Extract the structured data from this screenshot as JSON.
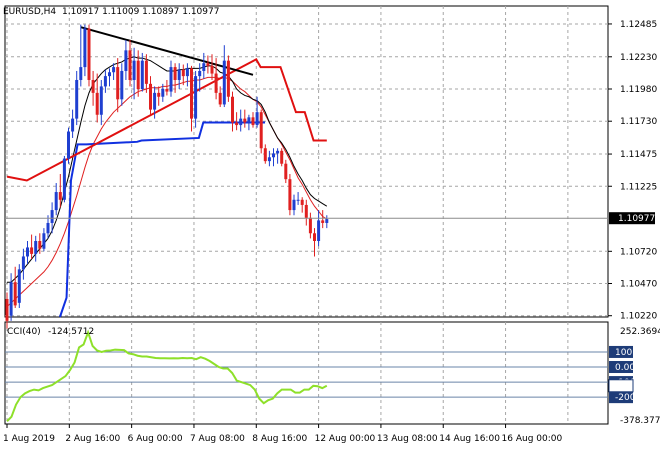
{
  "header": {
    "symbol": "EURUSD,H4",
    "ohlc": "1.10917 1.11009 1.10897 1.10977"
  },
  "indicator": {
    "name": "CCI(40)",
    "value": "-124.5712"
  },
  "colors": {
    "bull": "#1f3fd0",
    "bear": "#e02020",
    "ma_fast": "#000000",
    "ma_slow": "#e02020",
    "stop_blue": "#1030e0",
    "stop_red": "#e01010",
    "trendline": "#000000",
    "cci": "#8ee02a",
    "grid": "#a6a6a6",
    "level": "#6a84a8"
  },
  "chart_data": [
    {
      "type": "candlestick",
      "title": "EURUSD,H4",
      "x_tick_labels": [
        "1 Aug 2019",
        "2 Aug 16:00",
        "6 Aug 00:00",
        "7 Aug 08:00",
        "8 Aug 16:00",
        "12 Aug 00:00",
        "13 Aug 08:00",
        "14 Aug 16:00",
        "16 Aug 00:00"
      ],
      "y_tick_labels": [
        "1.12485",
        "1.12230",
        "1.11980",
        "1.11730",
        "1.11475",
        "1.11225",
        "1.10720",
        "1.10470",
        "1.10220"
      ],
      "ylim": [
        1.1021,
        1.1257
      ],
      "price_label": "1.10977",
      "candles": [
        [
          1.1035,
          1.104,
          1.1012,
          1.1018
        ],
        [
          1.1022,
          1.1055,
          1.1018,
          1.1048
        ],
        [
          1.1048,
          1.106,
          1.1028,
          1.103
        ],
        [
          1.1032,
          1.1062,
          1.1028,
          1.1058
        ],
        [
          1.1058,
          1.1074,
          1.105,
          1.1068
        ],
        [
          1.1068,
          1.108,
          1.1062,
          1.1075
        ],
        [
          1.1075,
          1.1085,
          1.1066,
          1.107
        ],
        [
          1.107,
          1.1084,
          1.1064,
          1.108
        ],
        [
          1.108,
          1.1086,
          1.107,
          1.1074
        ],
        [
          1.1074,
          1.109,
          1.1072,
          1.1086
        ],
        [
          1.1086,
          1.11,
          1.1082,
          1.1094
        ],
        [
          1.1094,
          1.111,
          1.1086,
          1.1104
        ],
        [
          1.1104,
          1.1125,
          1.11,
          1.1118
        ],
        [
          1.1118,
          1.1132,
          1.1106,
          1.1112
        ],
        [
          1.1112,
          1.1146,
          1.111,
          1.1144
        ],
        [
          1.1144,
          1.1168,
          1.114,
          1.1165
        ],
        [
          1.1165,
          1.1182,
          1.116,
          1.1175
        ],
        [
          1.1175,
          1.1212,
          1.117,
          1.1205
        ],
        [
          1.1205,
          1.1248,
          1.12,
          1.1215
        ],
        [
          1.1215,
          1.1248,
          1.1208,
          1.1245
        ],
        [
          1.1245,
          1.1248,
          1.12,
          1.1205
        ],
        [
          1.1205,
          1.1212,
          1.1185,
          1.1195
        ],
        [
          1.1195,
          1.121,
          1.1172,
          1.1178
        ],
        [
          1.1178,
          1.1205,
          1.117,
          1.12
        ],
        [
          1.12,
          1.1213,
          1.1195,
          1.1208
        ],
        [
          1.1208,
          1.1214,
          1.12,
          1.1211
        ],
        [
          1.1211,
          1.1218,
          1.1205,
          1.1215
        ],
        [
          1.1215,
          1.1222,
          1.118,
          1.119
        ],
        [
          1.119,
          1.1218,
          1.1185,
          1.1212
        ],
        [
          1.1212,
          1.1236,
          1.1205,
          1.1228
        ],
        [
          1.1228,
          1.1236,
          1.12,
          1.1205
        ],
        [
          1.1205,
          1.123,
          1.119,
          1.122
        ],
        [
          1.122,
          1.1228,
          1.1192,
          1.1198
        ],
        [
          1.1198,
          1.1226,
          1.1196,
          1.122
        ],
        [
          1.122,
          1.1225,
          1.1195,
          1.1202
        ],
        [
          1.1202,
          1.1208,
          1.1178,
          1.1182
        ],
        [
          1.1182,
          1.12,
          1.1175,
          1.1195
        ],
        [
          1.1195,
          1.12,
          1.1185,
          1.1192
        ],
        [
          1.1192,
          1.1202,
          1.1188,
          1.1198
        ],
        [
          1.1198,
          1.1205,
          1.1193,
          1.1196
        ],
        [
          1.1196,
          1.122,
          1.1192,
          1.1215
        ],
        [
          1.1215,
          1.1218,
          1.1195,
          1.1205
        ],
        [
          1.1205,
          1.1218,
          1.1198,
          1.1213
        ],
        [
          1.1213,
          1.1217,
          1.1201,
          1.1208
        ],
        [
          1.1208,
          1.1218,
          1.12,
          1.1214
        ],
        [
          1.1214,
          1.1216,
          1.1165,
          1.1175
        ],
        [
          1.1175,
          1.1212,
          1.1168,
          1.1208
        ],
        [
          1.1208,
          1.1218,
          1.1196,
          1.1212
        ],
        [
          1.1212,
          1.1226,
          1.1206,
          1.1218
        ],
        [
          1.1218,
          1.1224,
          1.121,
          1.1216
        ],
        [
          1.1216,
          1.1225,
          1.1205,
          1.121
        ],
        [
          1.121,
          1.1222,
          1.119,
          1.1195
        ],
        [
          1.1195,
          1.12,
          1.1184,
          1.1186
        ],
        [
          1.1186,
          1.1232,
          1.1184,
          1.122
        ],
        [
          1.122,
          1.1224,
          1.1188,
          1.1192
        ],
        [
          1.1192,
          1.1196,
          1.1165,
          1.1172
        ],
        [
          1.1172,
          1.118,
          1.1166,
          1.117
        ],
        [
          1.117,
          1.1182,
          1.1165,
          1.1175
        ],
        [
          1.1175,
          1.1182,
          1.1168,
          1.1172
        ],
        [
          1.1172,
          1.1178,
          1.1166,
          1.1176
        ],
        [
          1.1176,
          1.118,
          1.1168,
          1.117
        ],
        [
          1.117,
          1.1192,
          1.1168,
          1.118
        ],
        [
          1.118,
          1.1182,
          1.1148,
          1.1152
        ],
        [
          1.1152,
          1.1155,
          1.114,
          1.1142
        ],
        [
          1.1142,
          1.115,
          1.1138,
          1.1145
        ],
        [
          1.1145,
          1.1152,
          1.1138,
          1.1148
        ],
        [
          1.1148,
          1.1152,
          1.114,
          1.115
        ],
        [
          1.115,
          1.1152,
          1.1138,
          1.114
        ],
        [
          1.114,
          1.1143,
          1.1125,
          1.1128
        ],
        [
          1.1128,
          1.1132,
          1.11,
          1.1104
        ],
        [
          1.1104,
          1.1116,
          1.11,
          1.1112
        ],
        [
          1.1112,
          1.1118,
          1.1108,
          1.1112
        ],
        [
          1.1112,
          1.1114,
          1.1102,
          1.1108
        ],
        [
          1.1108,
          1.1112,
          1.1092,
          1.1098
        ],
        [
          1.1098,
          1.1102,
          1.1082,
          1.1086
        ],
        [
          1.1086,
          1.109,
          1.1068,
          1.108
        ],
        [
          1.108,
          1.1104,
          1.1076,
          1.1096
        ],
        [
          1.1096,
          1.1104,
          1.109,
          1.1094
        ],
        [
          1.1094,
          1.11,
          1.109,
          1.1097
        ]
      ],
      "ma_fast": [
        1.1048,
        1.1048,
        1.1051,
        1.1054,
        1.1058,
        1.1062,
        1.1066,
        1.107,
        1.1074,
        1.1078,
        1.1082,
        1.1088,
        1.1096,
        1.1106,
        1.1118,
        1.113,
        1.1144,
        1.1158,
        1.1172,
        1.1185,
        1.1195,
        1.1202,
        1.1206,
        1.121,
        1.1213,
        1.1215,
        1.1217,
        1.1218,
        1.1219,
        1.1221,
        1.1222,
        1.1223,
        1.1222,
        1.1222,
        1.1221,
        1.122,
        1.1218,
        1.1216,
        1.1214,
        1.1212,
        1.1212,
        1.1212,
        1.1213,
        1.1213,
        1.1214,
        1.1214,
        1.1214,
        1.1214,
        1.1215,
        1.1216,
        1.1216,
        1.1214,
        1.1211,
        1.121,
        1.1208,
        1.1204,
        1.1198,
        1.1195,
        1.1193,
        1.1192,
        1.119,
        1.1189,
        1.1186,
        1.118,
        1.1172,
        1.1166,
        1.116,
        1.1156,
        1.1151,
        1.1145,
        1.1138,
        1.1132,
        1.1127,
        1.1121,
        1.1116,
        1.1113,
        1.1111,
        1.1109,
        1.1107
      ],
      "ma_slow": [
        1.1029,
        1.1032,
        1.1035,
        1.1038,
        1.1041,
        1.1044,
        1.1047,
        1.105,
        1.1053,
        1.1056,
        1.106,
        1.1065,
        1.1071,
        1.1078,
        1.1086,
        1.1095,
        1.1105,
        1.1115,
        1.1126,
        1.1137,
        1.1147,
        1.1155,
        1.1161,
        1.1167,
        1.1172,
        1.1176,
        1.118,
        1.1183,
        1.1186,
        1.1189,
        1.1192,
        1.1194,
        1.1196,
        1.1197,
        1.1198,
        1.1199,
        1.1199,
        1.1199,
        1.12,
        1.12,
        1.1201,
        1.1201,
        1.1202,
        1.1203,
        1.1204,
        1.1204,
        1.1205,
        1.1205,
        1.1206,
        1.1207,
        1.1207,
        1.1207,
        1.1206,
        1.1207,
        1.1206,
        1.1204,
        1.1201,
        1.1198,
        1.1196,
        1.1193,
        1.119,
        1.1188,
        1.1184,
        1.1178,
        1.1172,
        1.1166,
        1.116,
        1.1155,
        1.1149,
        1.1143,
        1.1136,
        1.1129,
        1.1124,
        1.1118,
        1.1112,
        1.1107,
        1.1103,
        1.1099,
        1.1097
      ],
      "stop_blue": [
        [
          24,
          1.1021
        ],
        [
          27,
          1.1036
        ],
        [
          29,
          1.1127
        ],
        [
          32,
          1.1155
        ],
        [
          36,
          1.1155
        ],
        [
          59,
          1.1157
        ],
        [
          61,
          1.1158
        ],
        [
          87,
          1.116
        ],
        [
          89,
          1.1172
        ],
        [
          117,
          1.1172
        ]
      ],
      "stop_red": [
        [
          0,
          1.113
        ],
        [
          9,
          1.1127
        ],
        [
          113,
          1.1221
        ],
        [
          115,
          1.1215
        ],
        [
          124,
          1.1215
        ],
        [
          131,
          1.118
        ],
        [
          135,
          1.118
        ],
        [
          139,
          1.1158
        ],
        [
          145,
          1.1158
        ]
      ],
      "trendline": [
        [
          1.1246,
          1.1209
        ]
      ]
    },
    {
      "type": "line",
      "title": "CCI(40)",
      "y_tick_labels": [
        "252.3694",
        "100",
        "0.00",
        "-100",
        "-200",
        "-378.3777"
      ],
      "levels": [
        100,
        0,
        -100,
        -200
      ],
      "ylim": [
        -378.3777,
        252.3694
      ],
      "current_label": "-124.5712",
      "values": [
        -360,
        -330,
        -250,
        -200,
        -175,
        -160,
        -150,
        -155,
        -140,
        -130,
        -120,
        -100,
        -80,
        -60,
        -20,
        30,
        130,
        150,
        230,
        140,
        110,
        100,
        108,
        110,
        115,
        114,
        112,
        90,
        85,
        75,
        70,
        70,
        65,
        60,
        58,
        58,
        57,
        58,
        57,
        60,
        58,
        60,
        52,
        65,
        55,
        40,
        20,
        0,
        -10,
        -10,
        -40,
        -90,
        -100,
        -110,
        -120,
        -150,
        -210,
        -240,
        -220,
        -210,
        -175,
        -150,
        -150,
        -150,
        -170,
        -170,
        -150,
        -150,
        -125,
        -128,
        -140,
        -124.5712
      ]
    }
  ]
}
